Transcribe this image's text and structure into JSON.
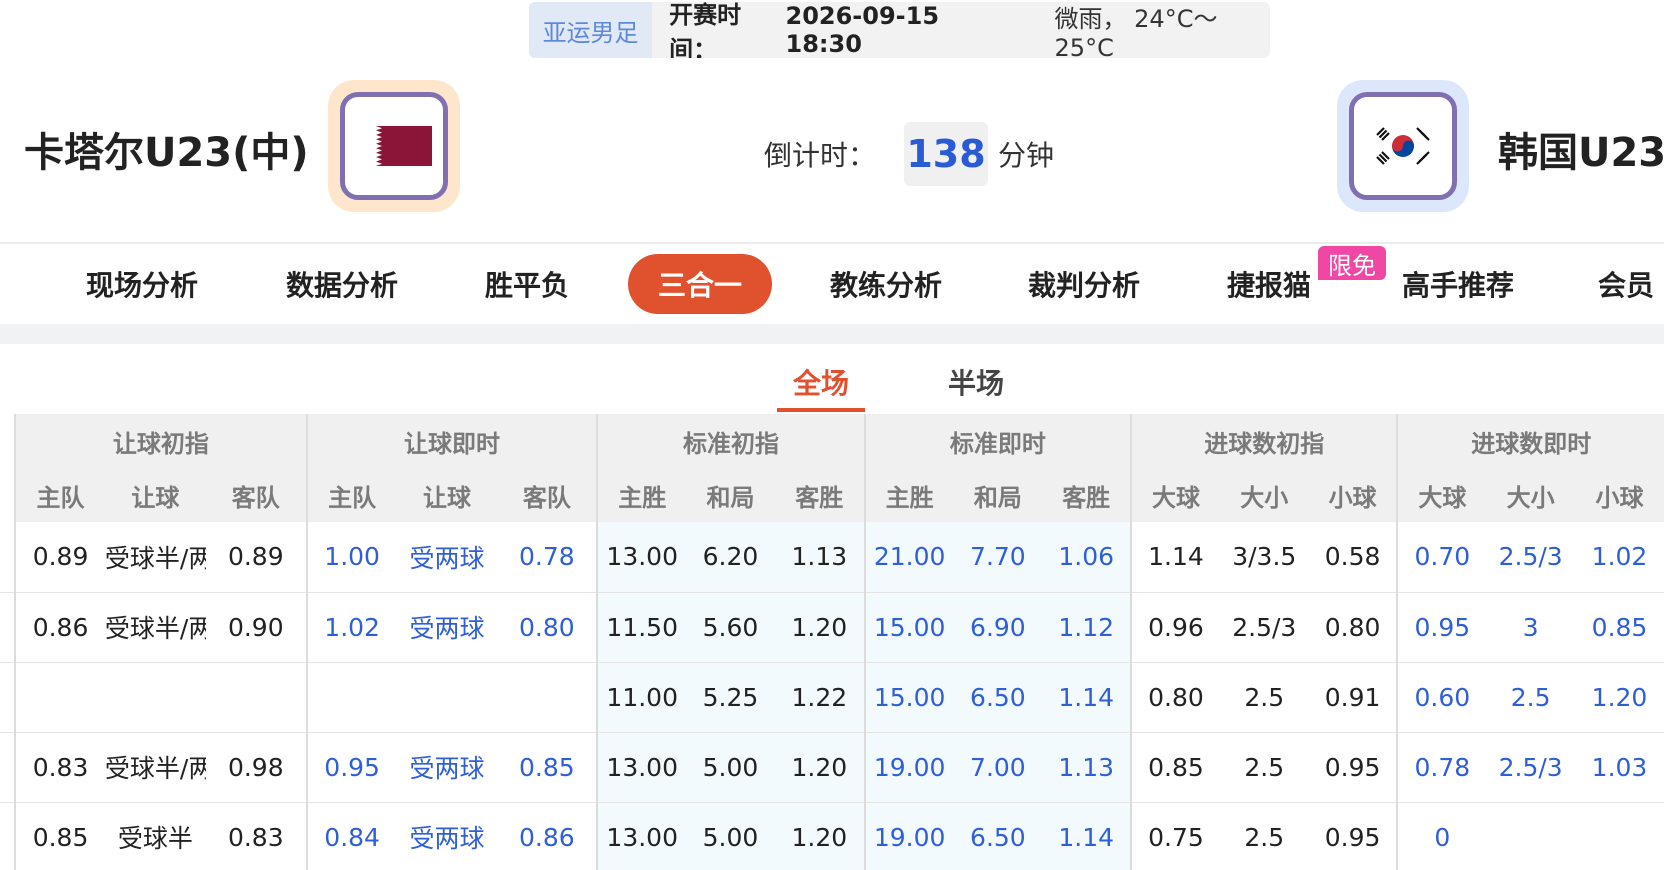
{
  "match": {
    "league": "亚运男足",
    "kickoff_label": "开赛时间：",
    "kickoff_time": "2026-09-15 18:30",
    "weather": "微雨， 24°C～25°C"
  },
  "home": {
    "name": "卡塔尔U23(中)",
    "flag_colors": {
      "white": "#ffffff",
      "maroon": "#8a1538"
    }
  },
  "away": {
    "name": "韩国U23"
  },
  "countdown": {
    "label": "倒计时：",
    "value": "138",
    "unit": "分钟"
  },
  "nav": {
    "items": [
      {
        "label": "现场分析"
      },
      {
        "label": "数据分析"
      },
      {
        "label": "胜平负"
      },
      {
        "label": "三合一",
        "active": true
      },
      {
        "label": "教练分析"
      },
      {
        "label": "裁判分析"
      },
      {
        "label": "捷报猫"
      },
      {
        "label": "高手推荐"
      },
      {
        "label": "会员"
      }
    ],
    "badge": "限免"
  },
  "sub_tabs": [
    {
      "label": "全场",
      "active": true
    },
    {
      "label": "半场"
    }
  ],
  "colors": {
    "accent": "#e0512e",
    "blue": "#2f5fd6",
    "badge": "#f047a5"
  },
  "table": {
    "groups": [
      "让球初指",
      "让球即时",
      "标准初指",
      "标准即时",
      "进球数初指",
      "进球数即时"
    ],
    "subheaders": [
      "主队",
      "让球",
      "客队",
      "主队",
      "让球",
      "客队",
      "主胜",
      "和局",
      "客胜",
      "主胜",
      "和局",
      "客胜",
      "大球",
      "大小",
      "小球",
      "大球",
      "大小",
      "小球"
    ],
    "rows": [
      [
        "0.89",
        "受球半/两",
        "0.89",
        "1.00",
        "受两球",
        "0.78",
        "13.00",
        "6.20",
        "1.13",
        "21.00",
        "7.70",
        "1.06",
        "1.14",
        "3/3.5",
        "0.58",
        "0.70",
        "2.5/3",
        "1.02"
      ],
      [
        "0.86",
        "受球半/两",
        "0.90",
        "1.02",
        "受两球",
        "0.80",
        "11.50",
        "5.60",
        "1.20",
        "15.00",
        "6.90",
        "1.12",
        "0.96",
        "2.5/3",
        "0.80",
        "0.95",
        "3",
        "0.85"
      ],
      [
        "",
        "",
        "",
        "",
        "",
        "",
        "11.00",
        "5.25",
        "1.22",
        "15.00",
        "6.50",
        "1.14",
        "0.80",
        "2.5",
        "0.91",
        "0.60",
        "2.5",
        "1.20"
      ],
      [
        "0.83",
        "受球半/两",
        "0.98",
        "0.95",
        "受两球",
        "0.85",
        "13.00",
        "5.00",
        "1.20",
        "19.00",
        "7.00",
        "1.13",
        "0.85",
        "2.5",
        "0.95",
        "0.78",
        "2.5/3",
        "1.03"
      ],
      [
        "0.85",
        "受球半",
        "0.83",
        "0.84",
        "受两球",
        "0.86",
        "13.00",
        "5.00",
        "1.20",
        "19.00",
        "6.50",
        "1.14",
        "0.75",
        "2.5",
        "0.95",
        "0",
        "",
        ""
      ]
    ]
  }
}
